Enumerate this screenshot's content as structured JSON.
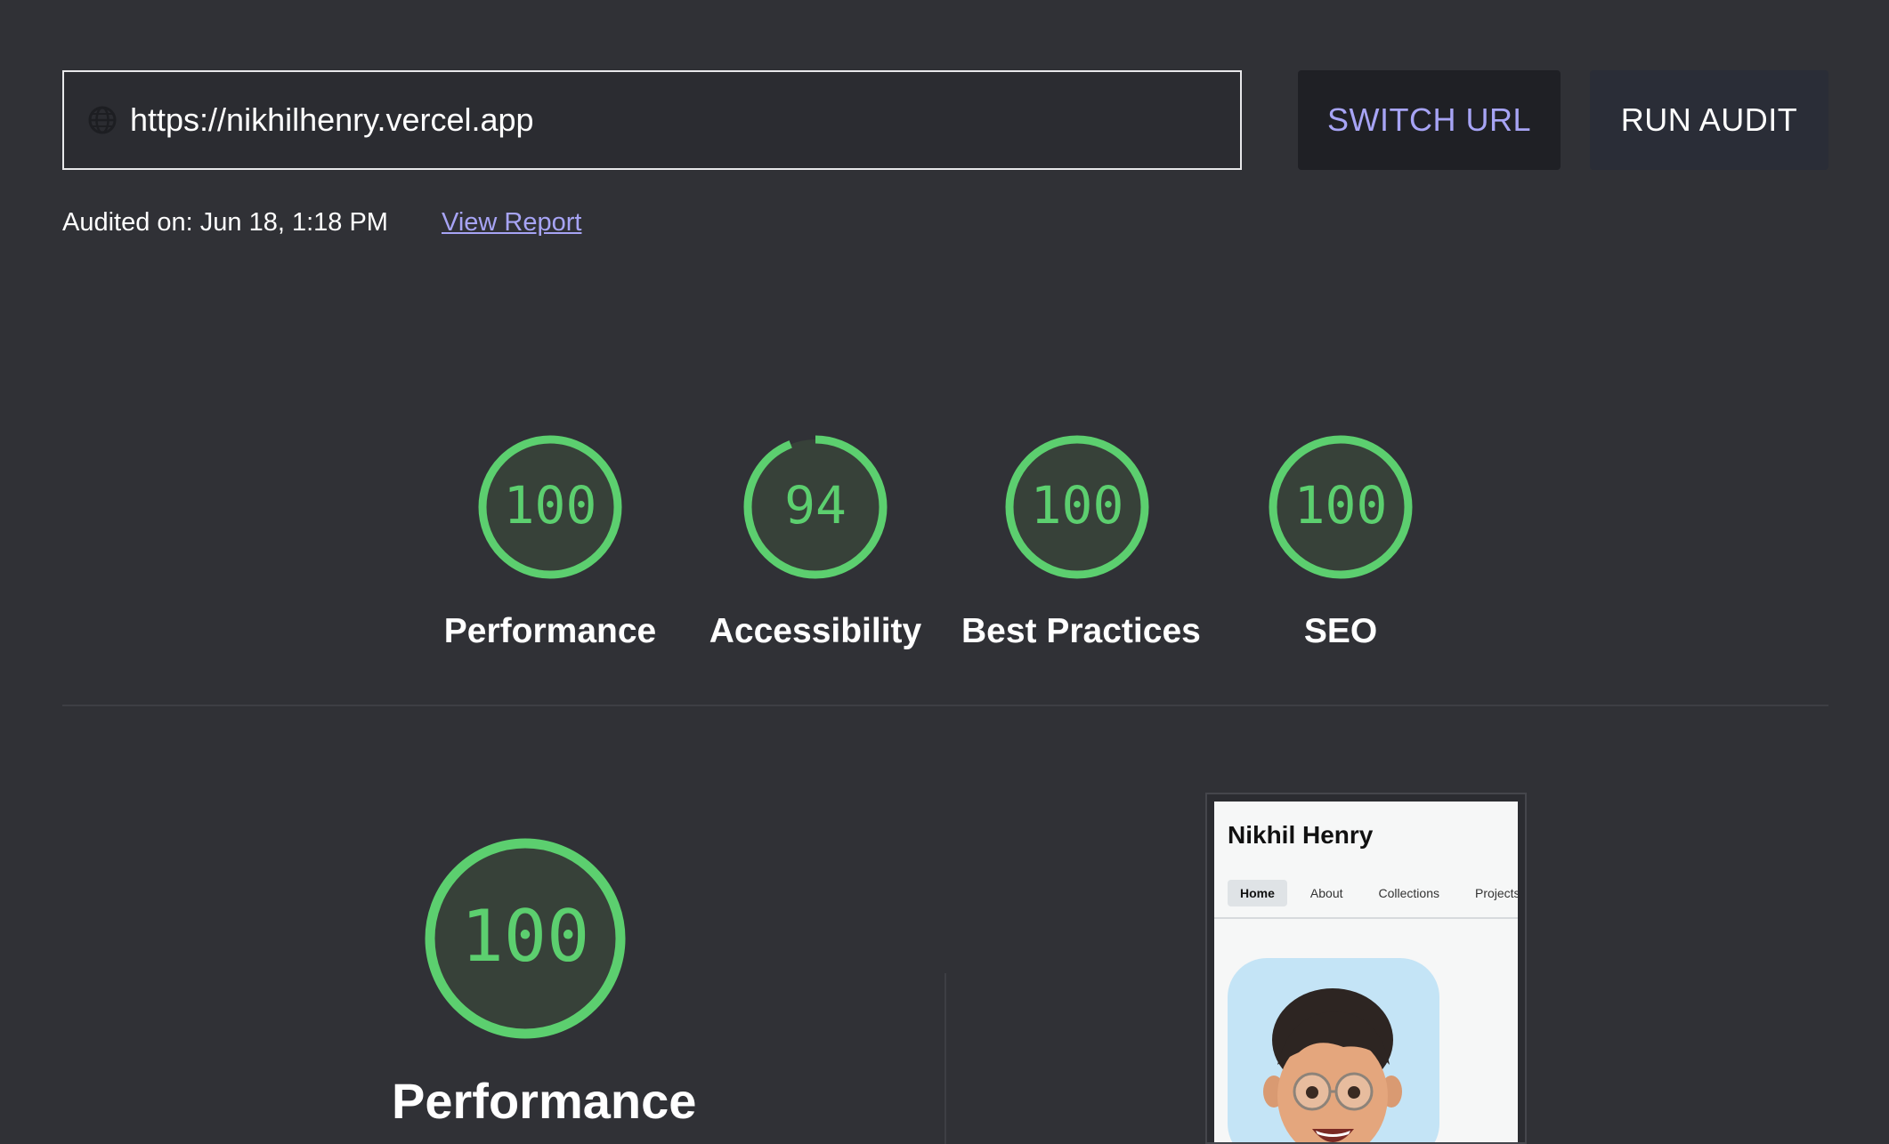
{
  "toolbar": {
    "url_value": "https://nikhilhenry.vercel.app",
    "switch_url_label": "SWITCH URL",
    "run_audit_label": "RUN AUDIT"
  },
  "meta": {
    "audited_on": "Audited on: Jun 18, 1:18 PM",
    "view_report_label": "View Report"
  },
  "scores": [
    {
      "value": "100",
      "label": "Performance",
      "fraction": 1.0
    },
    {
      "value": "94",
      "label": "Accessibility",
      "fraction": 0.94
    },
    {
      "value": "100",
      "label": "Best Practices",
      "fraction": 1.0
    },
    {
      "value": "100",
      "label": "SEO",
      "fraction": 1.0
    }
  ],
  "detail": {
    "score_value": "100",
    "score_label": "Performance",
    "score_fraction": 1.0
  },
  "preview": {
    "site_title": "Nikhil Henry",
    "nav": [
      "Home",
      "About",
      "Collections",
      "Projects"
    ],
    "active_nav": "Home"
  },
  "colors": {
    "background": "#303136",
    "score_green": "#5ccf6f",
    "accent_link": "#a7a4f5"
  }
}
